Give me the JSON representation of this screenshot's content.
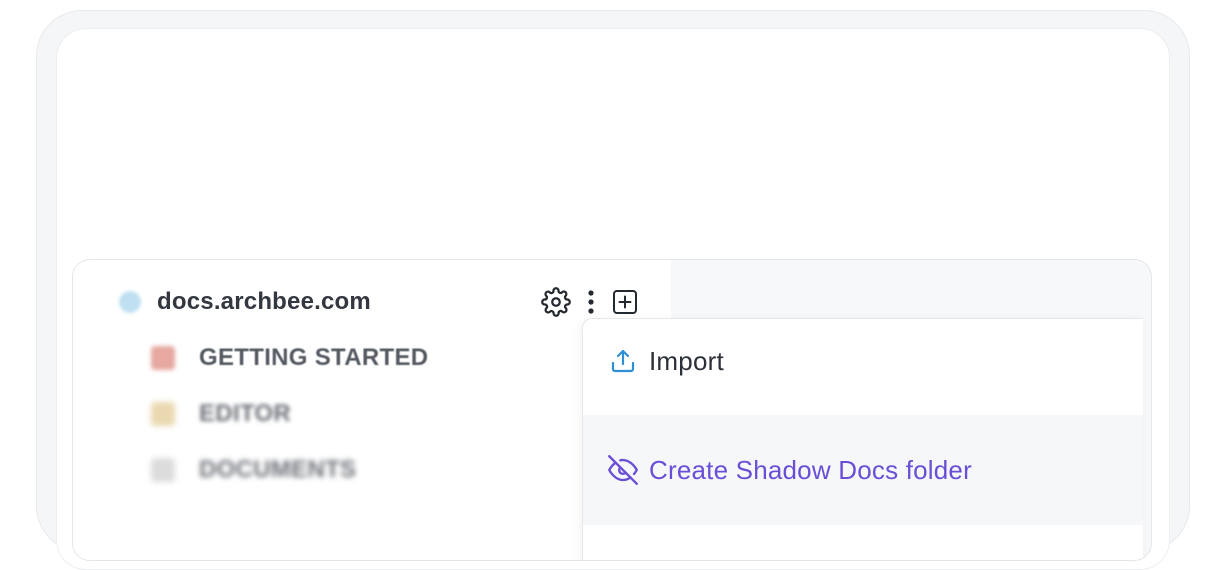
{
  "site": {
    "name": "docs.archbee.com",
    "icon": "globe-icon"
  },
  "toolbar": {
    "settings_icon": "gear-icon",
    "more_icon": "kebab-icon",
    "add_icon": "plus-square-icon"
  },
  "sidebar": {
    "items": [
      {
        "label": "GETTING STARTED",
        "icon": "rocket-icon"
      },
      {
        "label": "EDITOR",
        "icon": "folder-icon"
      },
      {
        "label": "DOCUMENTS",
        "icon": "document-icon"
      }
    ]
  },
  "menu": {
    "items": [
      {
        "label": "Import",
        "icon": "upload-icon",
        "icon_color": "#2f8fd6"
      },
      {
        "label": "Create Shadow Docs folder",
        "icon": "eye-off-icon",
        "icon_color": "#6a4fd6"
      }
    ]
  },
  "colors": {
    "accent": "#6a4fd6",
    "import_icon": "#2f8fd6",
    "text": "#2c3038"
  }
}
